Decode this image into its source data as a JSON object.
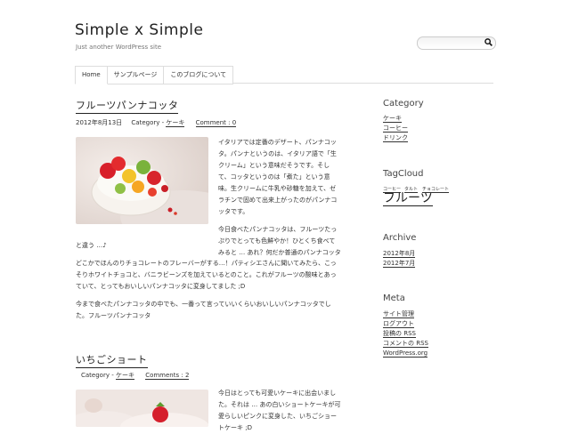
{
  "site": {
    "title": "Simple x Simple",
    "description": "Just another WordPress site"
  },
  "search": {
    "placeholder": "",
    "icon": "search-icon"
  },
  "nav": {
    "tabs": [
      "Home",
      "サンプルページ",
      "このブログについて"
    ]
  },
  "posts": [
    {
      "title": "フルーツパンナコッタ",
      "date": "2012年8月13日",
      "category_label": "Category - ",
      "category": "ケーキ",
      "comments": "Comment : 0",
      "side_lines": [
        "イタリアでは定番のデザート、パンナコッ",
        "タ。パンナというのは、イタリア語で「生",
        "クリーム」という意味だそうです。そし",
        "て、コッタというのは「煮た」という意",
        "味。生クリームに牛乳や砂糖を加えて、ゼ",
        "ラチンで固めて出来上がったのがパンナコ",
        "ッタです。"
      ],
      "side_lines2": [
        "今日食べたパンナコッタは、フルーツたっ",
        "ぷりでとっても色鮮やか！ひとくち食べて",
        "みると … あれ？何だか普通のパンナコッタ"
      ],
      "cont_line": "と違う …♪",
      "para2": [
        "どこかでほんのりチョコレートのフレーバーがする…！パティシエさんに聞いてみたら、こっ",
        "そりホワイトチョコと、バニラビーンズを加えているとのこと。これがフルーツの酸味とあっ",
        "ていて、とってもおいしいパンナコッタに変身してました ;D"
      ],
      "para3": [
        "今まで食べたパンナコッタの中でも、一番って言っていいくらいおいしいパンナコッタでし",
        "た。フルーツパンナコッタ"
      ]
    },
    {
      "title": "いちごショート",
      "category_label": "Category - ",
      "category": "ケーキ",
      "comments": "Comments : 2",
      "side_lines": [
        "今日はとっても可愛いケーキに出会いまし",
        "た。それは … あの白いショートケーキが可",
        "愛らしいピンクに変身した、いちごショー",
        "トケーキ ;D"
      ]
    }
  ],
  "sidebar": {
    "category": {
      "heading": "Category",
      "items": [
        "ケーキ",
        "コーヒー",
        "ドリンク"
      ]
    },
    "tagcloud": {
      "heading": "TagCloud",
      "small_tags": [
        "コーヒー",
        "タルト",
        "チョコレート"
      ],
      "big_tag": "フルーツ"
    },
    "archive": {
      "heading": "Archive",
      "items": [
        "2012年8月",
        "2012年7月"
      ]
    },
    "meta": {
      "heading": "Meta",
      "items": [
        "サイト管理",
        "ログアウト",
        "投稿の RSS",
        "コメントの RSS",
        "WordPress.org"
      ]
    }
  }
}
